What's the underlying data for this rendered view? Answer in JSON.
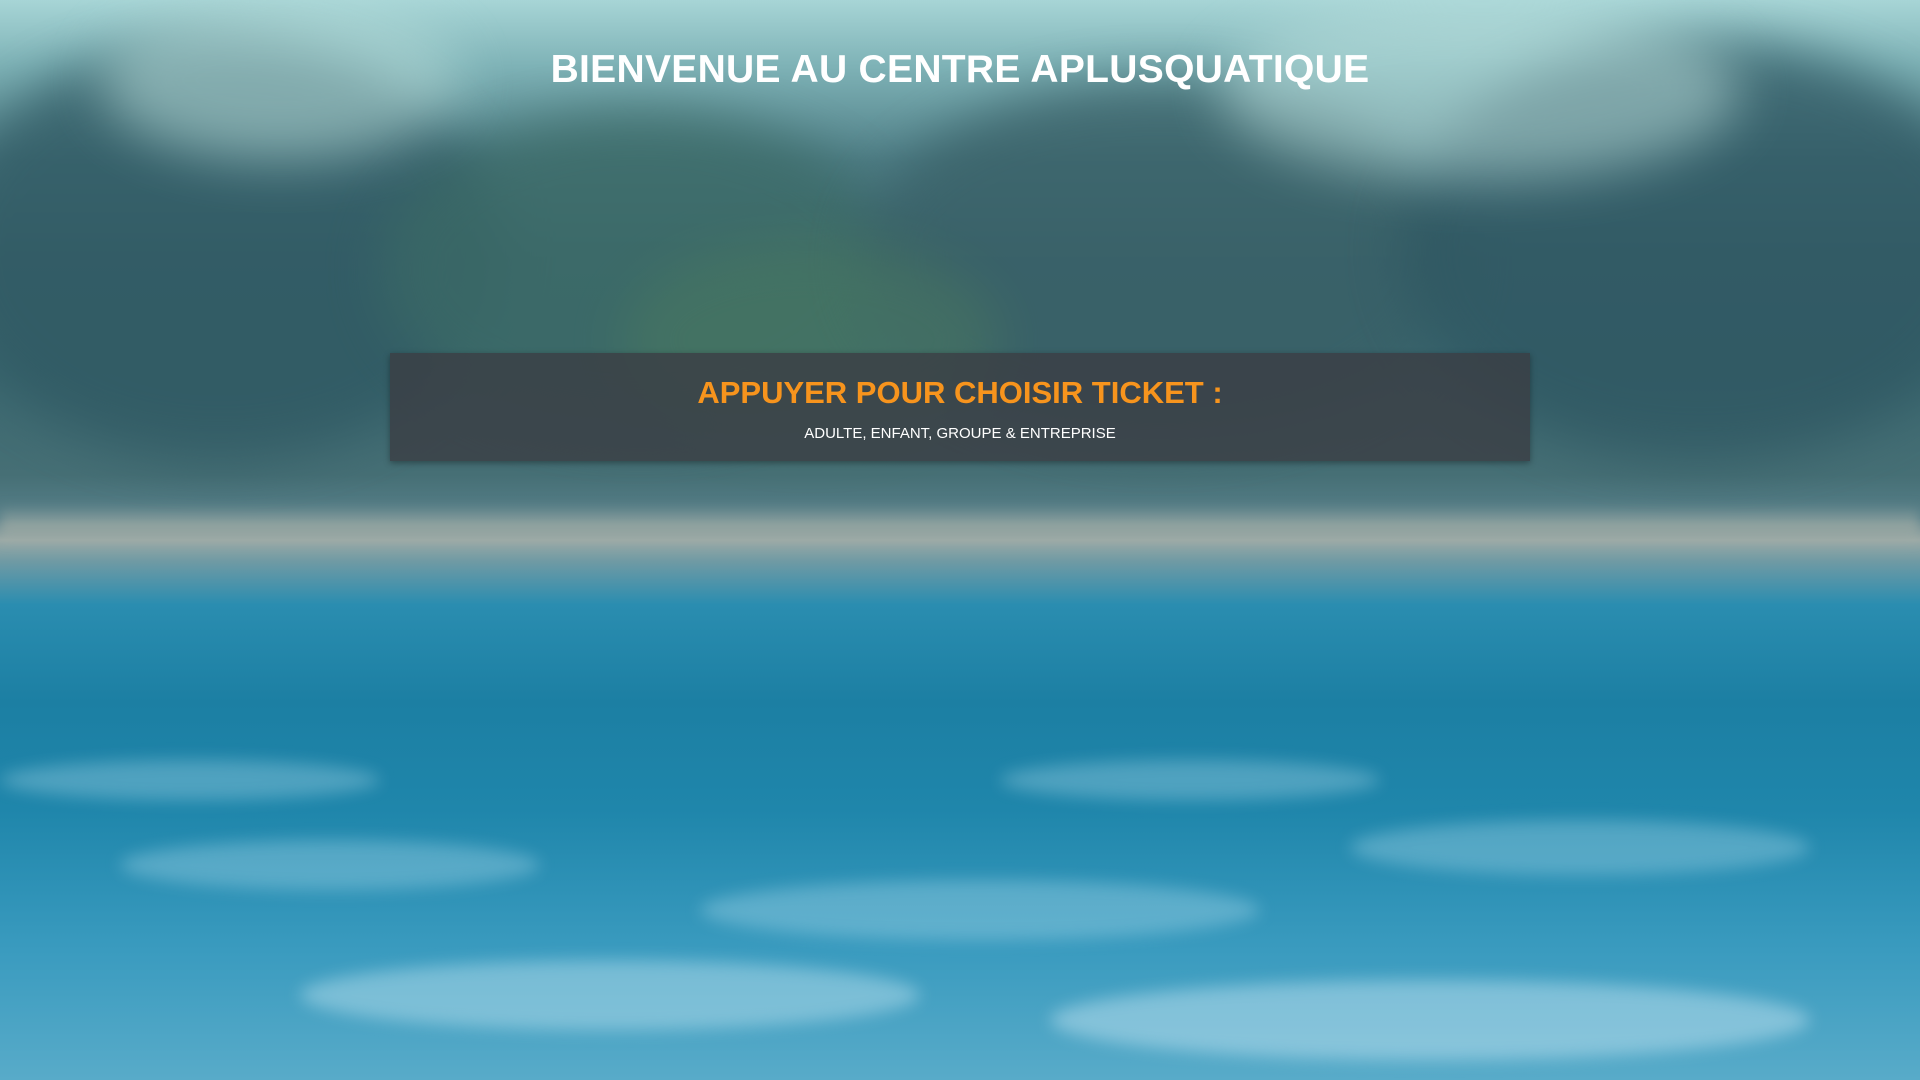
{
  "header": {
    "title": "BIENVENUE AU CENTRE APLUSQUATIQUE"
  },
  "ticket_panel": {
    "heading": "APPUYER POUR CHOISIR TICKET :",
    "subtitle": "ADULTE, ENFANT, GROUPE & ENTREPRISE"
  },
  "colors": {
    "accent": "#f7941d",
    "panel_background": "#3a3e44",
    "title_text": "#ffffff"
  }
}
